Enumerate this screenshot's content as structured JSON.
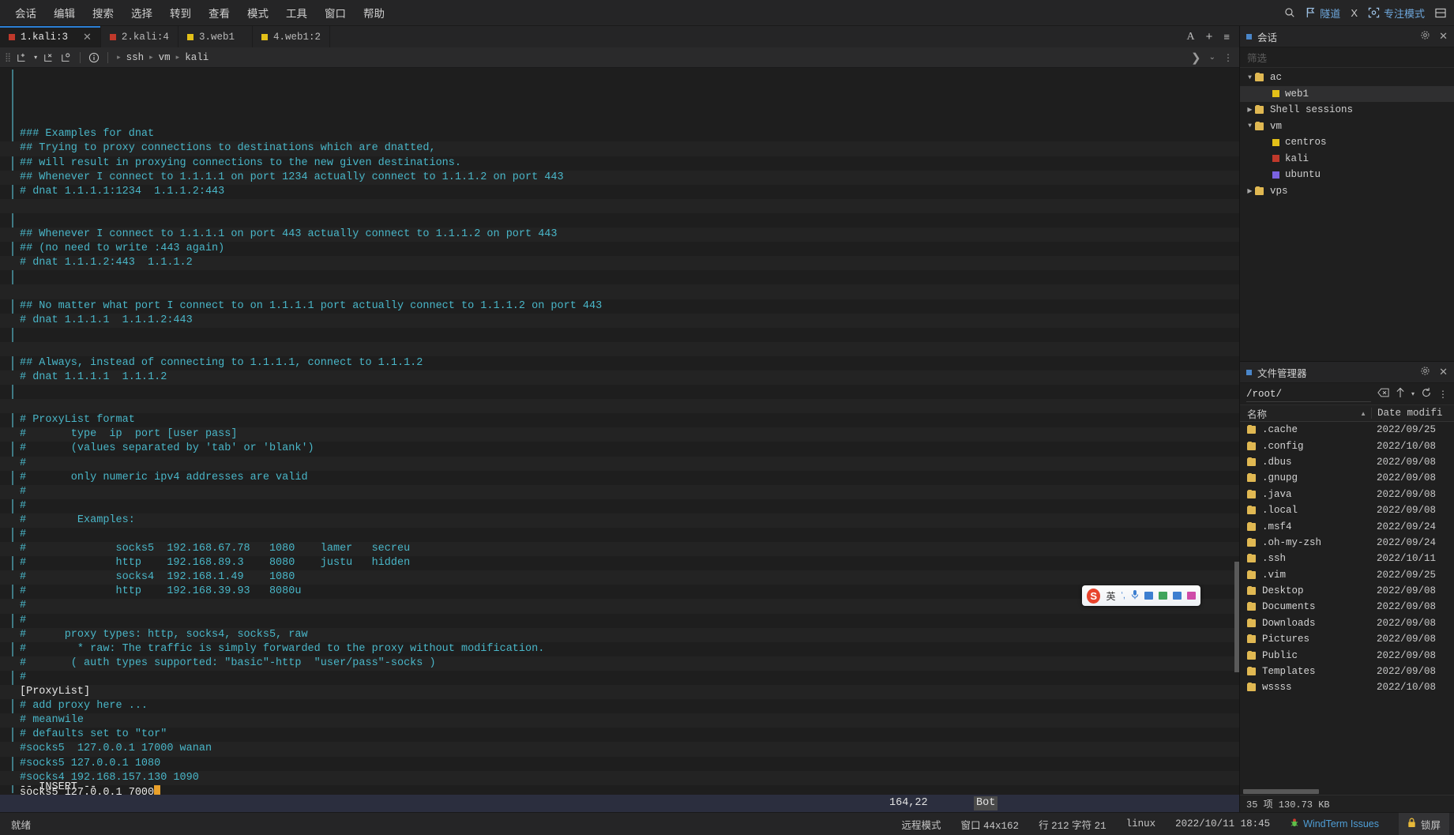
{
  "menubar": {
    "items": [
      "会话",
      "编辑",
      "搜索",
      "选择",
      "转到",
      "查看",
      "模式",
      "工具",
      "窗口",
      "帮助"
    ],
    "right": {
      "search_icon": "search-icon",
      "tunnel_icon": "flag-icon",
      "tunnel_label": "隧道",
      "x_label": "X",
      "focus_icon": "focus-icon",
      "focus_label": "专注模式",
      "layout_icon": "layout-icon"
    }
  },
  "tabs": [
    {
      "label": "1.kali:3",
      "color": "#c0392b",
      "active": true,
      "closable": true
    },
    {
      "label": "2.kali:4",
      "color": "#c0392b",
      "active": false,
      "closable": false
    },
    {
      "label": "3.web1",
      "color": "#e3c018",
      "active": false,
      "closable": false
    },
    {
      "label": "4.web1:2",
      "color": "#e3c018",
      "active": false,
      "closable": false
    }
  ],
  "tabbar_right": {
    "font_icon": "A",
    "add_icon": "+",
    "menu_icon": "≡"
  },
  "pathbar": {
    "new_tab_icon": "new-tab-icon",
    "dropdown_icon": "chevron-down-icon",
    "close_tab_icon": "close-tab-icon",
    "duplicate_icon": "duplicate-tab-icon",
    "info_icon": "info-icon",
    "crumbs": [
      "ssh",
      "vm",
      "kali"
    ],
    "expand_icon": "chevron-right-icon",
    "more_icon": "more-vertical-icon"
  },
  "terminal": {
    "lines": [
      {
        "t": "### Examples for dnat",
        "k": "cmt"
      },
      {
        "t": "## Trying to proxy connections to destinations which are dnatted,",
        "k": "cmt"
      },
      {
        "t": "## will result in proxying connections to the new given destinations.",
        "k": "cmt"
      },
      {
        "t": "## Whenever I connect to 1.1.1.1 on port 1234 actually connect to 1.1.1.2 on port 443",
        "k": "cmt"
      },
      {
        "t": "# dnat 1.1.1.1:1234  1.1.1.2:443",
        "k": "cmt"
      },
      {
        "t": "",
        "k": "cmt"
      },
      {
        "t": "",
        "k": "cmt"
      },
      {
        "t": "## Whenever I connect to 1.1.1.1 on port 443 actually connect to 1.1.1.2 on port 443",
        "k": "cmt"
      },
      {
        "t": "## (no need to write :443 again)",
        "k": "cmt"
      },
      {
        "t": "# dnat 1.1.1.2:443  1.1.1.2",
        "k": "cmt"
      },
      {
        "t": "",
        "k": "cmt"
      },
      {
        "t": "",
        "k": "cmt"
      },
      {
        "t": "## No matter what port I connect to on 1.1.1.1 port actually connect to 1.1.1.2 on port 443",
        "k": "cmt"
      },
      {
        "t": "# dnat 1.1.1.1  1.1.1.2:443",
        "k": "cmt"
      },
      {
        "t": "",
        "k": "cmt"
      },
      {
        "t": "",
        "k": "cmt"
      },
      {
        "t": "## Always, instead of connecting to 1.1.1.1, connect to 1.1.1.2",
        "k": "cmt"
      },
      {
        "t": "# dnat 1.1.1.1  1.1.1.2",
        "k": "cmt"
      },
      {
        "t": "",
        "k": "cmt"
      },
      {
        "t": "",
        "k": "cmt"
      },
      {
        "t": "# ProxyList format",
        "k": "cmt"
      },
      {
        "t": "#       type  ip  port [user pass]",
        "k": "cmt"
      },
      {
        "t": "#       (values separated by 'tab' or 'blank')",
        "k": "cmt"
      },
      {
        "t": "#",
        "k": "cmt"
      },
      {
        "t": "#       only numeric ipv4 addresses are valid",
        "k": "cmt"
      },
      {
        "t": "#",
        "k": "cmt"
      },
      {
        "t": "#",
        "k": "cmt"
      },
      {
        "t": "#        Examples:",
        "k": "cmt"
      },
      {
        "t": "#",
        "k": "cmt"
      },
      {
        "t": "#              socks5  192.168.67.78   1080    lamer   secreu",
        "k": "cmt"
      },
      {
        "t": "#              http    192.168.89.3    8080    justu   hidden",
        "k": "cmt"
      },
      {
        "t": "#              socks4  192.168.1.49    1080",
        "k": "cmt"
      },
      {
        "t": "#              http    192.168.39.93   8080u",
        "k": "cmt"
      },
      {
        "t": "#",
        "k": "cmt"
      },
      {
        "t": "#",
        "k": "cmt"
      },
      {
        "t": "#      proxy types: http, socks4, socks5, raw",
        "k": "cmt"
      },
      {
        "t": "#        * raw: The traffic is simply forwarded to the proxy without modification.",
        "k": "cmt"
      },
      {
        "t": "#       ( auth types supported: \"basic\"-http  \"user/pass\"-socks )",
        "k": "cmt"
      },
      {
        "t": "#",
        "k": "cmt"
      },
      {
        "t": "[ProxyList]",
        "k": "txt"
      },
      {
        "t": "# add proxy here ...",
        "k": "cmt"
      },
      {
        "t": "# meanwile",
        "k": "cmt"
      },
      {
        "t": "# defaults set to \"tor\"",
        "k": "cmt"
      },
      {
        "t": "#socks5  127.0.0.1 17000 wanan",
        "k": "cmt"
      },
      {
        "t": "#socks5 127.0.0.1 1080",
        "k": "cmt"
      },
      {
        "t": "#socks4 192.168.157.130 1090",
        "k": "cmt"
      },
      {
        "t": "socks5 127.0.0.1 7000",
        "k": "txt",
        "cursor": true
      }
    ],
    "mode_line": "-- INSERT --",
    "status_position": "164,22",
    "status_scroll": "Bot"
  },
  "sessions_panel": {
    "title": "会话",
    "gear_icon": "gear-icon",
    "close_icon": "close-icon",
    "filter_placeholder": "筛选",
    "tree": [
      {
        "label": "ac",
        "depth": 0,
        "type": "folder",
        "expanded": true,
        "selected": false
      },
      {
        "label": "web1",
        "depth": 1,
        "type": "session",
        "color": "#e3c018",
        "selected": true
      },
      {
        "label": "Shell sessions",
        "depth": 0,
        "type": "folder",
        "expanded": false,
        "selected": false
      },
      {
        "label": "vm",
        "depth": 0,
        "type": "folder",
        "expanded": true,
        "selected": false
      },
      {
        "label": "centros",
        "depth": 1,
        "type": "session",
        "color": "#e3c018",
        "selected": false
      },
      {
        "label": "kali",
        "depth": 1,
        "type": "session",
        "color": "#c0392b",
        "selected": false
      },
      {
        "label": "ubuntu",
        "depth": 1,
        "type": "session",
        "color": "#7a62e0",
        "selected": false
      },
      {
        "label": "vps",
        "depth": 0,
        "type": "folder",
        "expanded": false,
        "selected": false
      }
    ]
  },
  "filemanager_panel": {
    "title": "文件管理器",
    "gear_icon": "gear-icon",
    "close_icon": "close-icon",
    "path": "/root/",
    "clear_icon": "backspace-icon",
    "up_icon": "arrow-up-icon",
    "up_dropdown_icon": "chevron-down-icon",
    "refresh_icon": "refresh-icon",
    "more_icon": "more-vertical-icon",
    "columns": [
      "名称",
      "Date modifi"
    ],
    "sort_icon": "sort-asc-icon",
    "rows": [
      {
        "name": ".cache",
        "date": "2022/09/25"
      },
      {
        "name": ".config",
        "date": "2022/10/08"
      },
      {
        "name": ".dbus",
        "date": "2022/09/08"
      },
      {
        "name": ".gnupg",
        "date": "2022/09/08"
      },
      {
        "name": ".java",
        "date": "2022/09/08"
      },
      {
        "name": ".local",
        "date": "2022/09/08"
      },
      {
        "name": ".msf4",
        "date": "2022/09/24"
      },
      {
        "name": ".oh-my-zsh",
        "date": "2022/09/24"
      },
      {
        "name": ".ssh",
        "date": "2022/10/11"
      },
      {
        "name": ".vim",
        "date": "2022/09/25"
      },
      {
        "name": "Desktop",
        "date": "2022/09/08"
      },
      {
        "name": "Documents",
        "date": "2022/09/08"
      },
      {
        "name": "Downloads",
        "date": "2022/09/08"
      },
      {
        "name": "Pictures",
        "date": "2022/09/08"
      },
      {
        "name": "Public",
        "date": "2022/09/08"
      },
      {
        "name": "Templates",
        "date": "2022/09/08"
      },
      {
        "name": "wssss",
        "date": "2022/10/08"
      }
    ],
    "footer": "35 项 130.73 KB"
  },
  "ime": {
    "logo": "S",
    "mode_label": "英",
    "punct_icon": "punctuation-icon",
    "mic_icon": "microphone-icon",
    "keyboard_icon": "keyboard-icon",
    "toolbox_icon": "toolbox-icon",
    "apps_icon": "apps-icon",
    "skin_icon": "skin-icon"
  },
  "statusbar": {
    "left": "就绪",
    "remote_mode": "远程模式",
    "window_label": "窗口",
    "window_size": "44x162",
    "row_label": "行",
    "row_value": "212",
    "char_label": "字符",
    "char_value": "21",
    "terminal_type": "linux",
    "datetime": "2022/10/11 18:45",
    "issues_icon": "bug-icon",
    "issues_label": "WindTerm Issues",
    "lock_icon": "lock-icon",
    "lock_label": "锁屏"
  },
  "colors": {
    "accent": "#2b7fd4",
    "comment": "#49b6c8",
    "cursor": "#e9a02b",
    "folder": "#e0b852"
  }
}
